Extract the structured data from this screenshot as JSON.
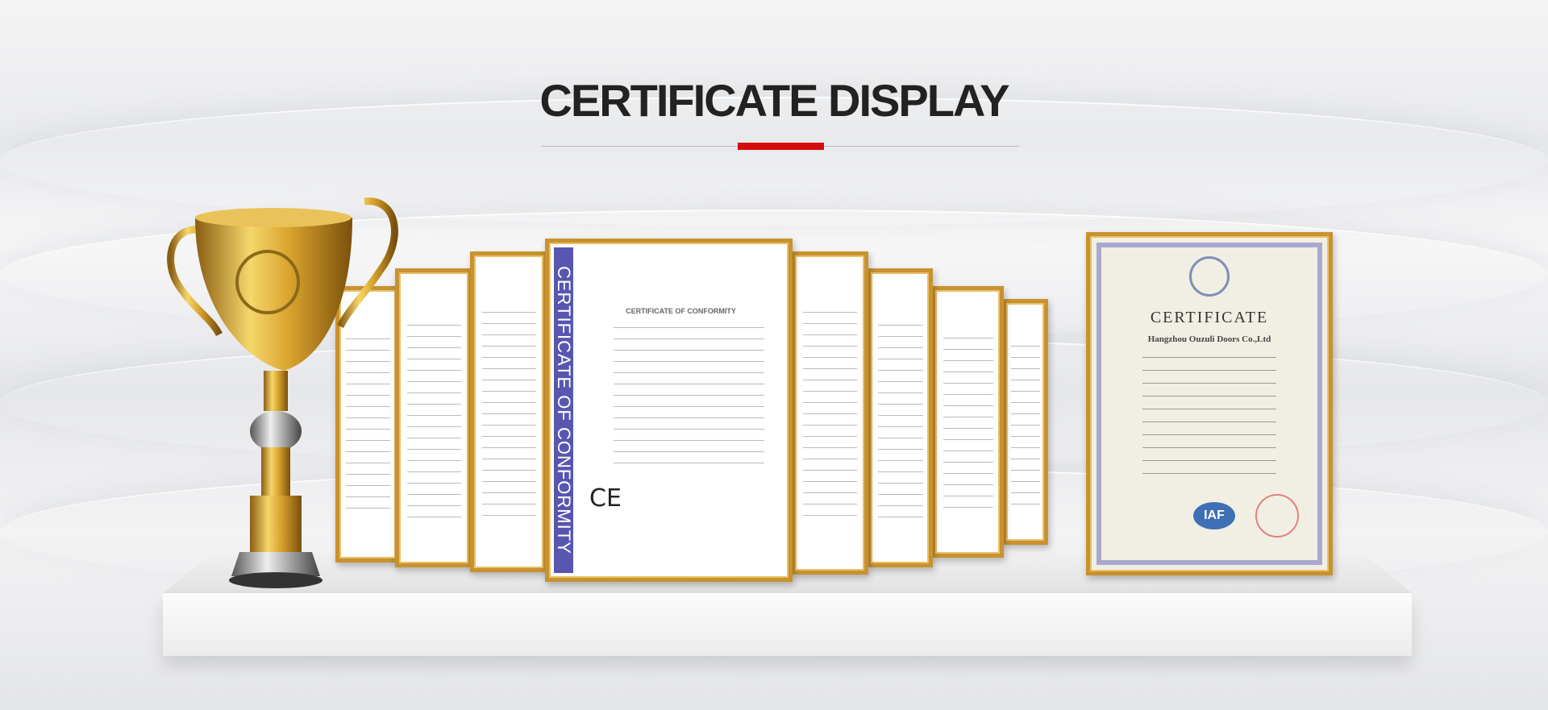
{
  "header": {
    "title": "CERTIFICATE DISPLAY"
  },
  "certificates": {
    "conformity": {
      "side_label": "CERTIFICATE OF CONFORMITY",
      "heading": "CERTIFICATE OF CONFORMITY",
      "mark": "CE"
    },
    "iso": {
      "heading": "CERTIFICATE",
      "company": "Hangzhou Ouzuli Doors Co.,Ltd",
      "badge": "IAF"
    }
  },
  "colors": {
    "accent": "#d40c0c",
    "frame": "#c8922e"
  }
}
